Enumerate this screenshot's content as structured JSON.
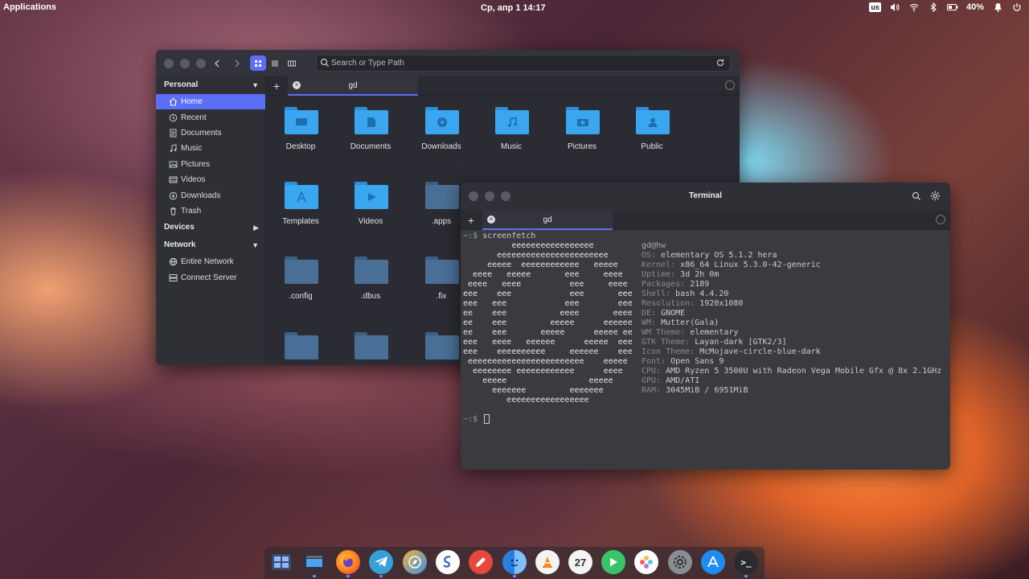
{
  "panel": {
    "applications": "Applications",
    "clock": "Ср, апр  1   14:17",
    "keyboard": "us",
    "battery": "40%"
  },
  "files": {
    "search_placeholder": "Search or Type Path",
    "sidebar": {
      "personal": "Personal",
      "items": [
        "Home",
        "Recent",
        "Documents",
        "Music",
        "Pictures",
        "Videos",
        "Downloads",
        "Trash"
      ],
      "devices": "Devices",
      "network": "Network",
      "network_items": [
        "Entire Network",
        "Connect Server"
      ]
    },
    "tab": {
      "label": "gd"
    },
    "folders": [
      "Desktop",
      "Documents",
      "Downloads",
      "Music",
      "Pictures",
      "Public",
      "Templates",
      "Videos",
      ".apps",
      ".config",
      ".dbus",
      ".fix"
    ]
  },
  "terminal": {
    "title": "Terminal",
    "tab": "gd",
    "command": "screenfetch",
    "prompt": "~:$ ",
    "user": "gd@hw",
    "info": [
      {
        "k": "OS:",
        "v": " elementary OS 5.1.2 hera"
      },
      {
        "k": "Kernel:",
        "v": " x86_64 Linux 5.3.0-42-generic"
      },
      {
        "k": "Uptime:",
        "v": " 3d 2h 0m"
      },
      {
        "k": "Packages:",
        "v": " 2189"
      },
      {
        "k": "Shell:",
        "v": " bash 4.4.20"
      },
      {
        "k": "Resolution:",
        "v": " 1920x1080"
      },
      {
        "k": "DE:",
        "v": " GNOME"
      },
      {
        "k": "WM:",
        "v": " Mutter(Gala)"
      },
      {
        "k": "WM Theme:",
        "v": " elementary"
      },
      {
        "k": "GTK Theme:",
        "v": " Layan-dark [GTK2/3]"
      },
      {
        "k": "Icon Theme:",
        "v": " McMojave-circle-blue-dark"
      },
      {
        "k": "Font:",
        "v": " Open Sans 9"
      },
      {
        "k": "CPU:",
        "v": " AMD Ryzen 5 3500U with Radeon Vega Mobile Gfx @ 8x 2.1GHz"
      },
      {
        "k": "GPU:",
        "v": " AMD/ATI"
      },
      {
        "k": "RAM:",
        "v": " 3045MiB / 6951MiB"
      }
    ],
    "ascii": [
      "          eeeeeeeeeeeeeeeee",
      "       eeeeeeeeeeeeeeeeeeeeeee",
      "     eeeee  eeeeeeeeeeee   eeeee",
      "  eeee   eeeee       eee     eeee",
      " eeee   eeee          eee     eeee",
      "eee    eee            eee       eee",
      "eee   eee            eee        eee",
      "ee    eee           eeee       eeee",
      "ee    eee         eeeee      eeeeee",
      "ee    eee       eeeee      eeeee ee",
      "eee   eeee   eeeeee      eeeee  eee",
      "eee    eeeeeeeeee     eeeeee    eee",
      " eeeeeeeeeeeeeeeeeeeeeeee    eeeee",
      "  eeeeeeee eeeeeeeeeeee      eeee",
      "    eeeee                 eeeee",
      "      eeeeeee         eeeeeee",
      "         eeeeeeeeeeeeeeeee"
    ]
  },
  "dock": {
    "calendar_day": "27",
    "terminal_glyph": ">_"
  },
  "colors": {
    "accent": "#5b6ef5",
    "folder": "#3aa6f0",
    "folder_hidden": "#4a6f96"
  }
}
